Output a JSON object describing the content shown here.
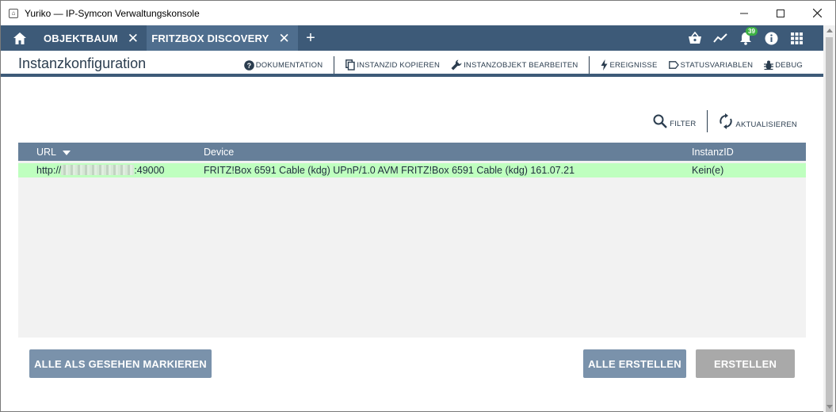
{
  "window": {
    "title": "Yuriko — IP-Symcon Verwaltungskonsole",
    "minimize": "—",
    "maximize": "☐",
    "close": "✕"
  },
  "tabs": [
    {
      "label": "OBJEKTBAUM",
      "close": "✕",
      "active": false
    },
    {
      "label": "FRITZBOX DISCOVERY",
      "close": "✕",
      "active": true
    }
  ],
  "add_tab": "+",
  "toolbar_icons": {
    "notifications_count": "39"
  },
  "subheader": {
    "title": "Instanzkonfiguration",
    "actions": [
      {
        "label": "DOKUMENTATION",
        "icon": "help-icon"
      },
      {
        "label": "INSTANZID KOPIEREN",
        "icon": "copy-icon"
      },
      {
        "label": "INSTANZOBJEKT BEARBEITEN",
        "icon": "wrench-icon"
      },
      {
        "label": "EREIGNISSE",
        "icon": "lightning-icon"
      },
      {
        "label": "STATUSVARIABLEN",
        "icon": "tag-icon"
      },
      {
        "label": "DEBUG",
        "icon": "bug-icon"
      }
    ]
  },
  "filter_bar": {
    "filter": "FILTER",
    "refresh": "AKTUALISIEREN"
  },
  "table": {
    "columns": [
      "URL",
      "Device",
      "InstanzID"
    ],
    "rows": [
      {
        "url_prefix": "http://",
        "url_suffix": ":49000",
        "device": "FRITZ!Box 6591 Cable (kdg) UPnP/1.0 AVM FRITZ!Box 6591 Cable (kdg) 161.07.21",
        "instance_id": "Kein(e)",
        "row_color": "#bfffbf"
      }
    ]
  },
  "buttons": {
    "mark_all_seen": "ALLE ALS GESEHEN MARKIEREN",
    "create_all": "ALLE ERSTELLEN",
    "create": "ERSTELLEN"
  },
  "colors": {
    "header_bar": "#3d5a78",
    "active_tab": "#4f6e8e",
    "table_header": "#667f99",
    "button_blue": "#7a92ab",
    "button_disabled": "#a9a9a9",
    "badge": "#3cb043"
  }
}
